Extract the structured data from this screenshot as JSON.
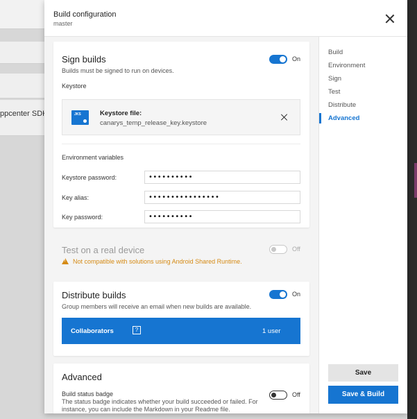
{
  "background": {
    "sdk_text": "ppcenter SDK"
  },
  "panel": {
    "title": "Build configuration",
    "subtitle": "master",
    "close_icon": "close-icon"
  },
  "sign": {
    "title": "Sign builds",
    "description": "Builds must be signed to run on devices.",
    "toggle_state": "On",
    "keystore_label": "Keystore",
    "keystore_title": "Keystore file:",
    "keystore_file": "canarys_temp_release_key.keystore",
    "env_label": "Environment variables",
    "fields": [
      {
        "label": "Keystore password:",
        "value": "••••••••••"
      },
      {
        "label": "Key alias:",
        "value": "••••••••••••••••"
      },
      {
        "label": "Key password:",
        "value": "••••••••••"
      }
    ]
  },
  "test": {
    "title": "Test on a real device",
    "toggle_state": "Off",
    "warning": "Not compatible with solutions using Android Shared Runtime."
  },
  "distribute": {
    "title": "Distribute builds",
    "description": "Group members will receive an email when new builds are available.",
    "toggle_state": "On",
    "collaborators_label": "Collaborators",
    "help_glyph": "?",
    "collaborators_count": "1 user"
  },
  "advanced": {
    "title": "Advanced",
    "badge_label": "Build status badge",
    "badge_desc": "The status badge indicates whether your build succeeded or failed. For instance, you can include the Markdown in your Readme file.",
    "toggle_state": "Off"
  },
  "nav": {
    "items": [
      "Build",
      "Environment",
      "Sign",
      "Test",
      "Distribute",
      "Advanced"
    ],
    "active": "Advanced"
  },
  "buttons": {
    "save": "Save",
    "save_build": "Save & Build"
  },
  "colors": {
    "accent": "#1675d1",
    "warning": "#d58a14"
  }
}
